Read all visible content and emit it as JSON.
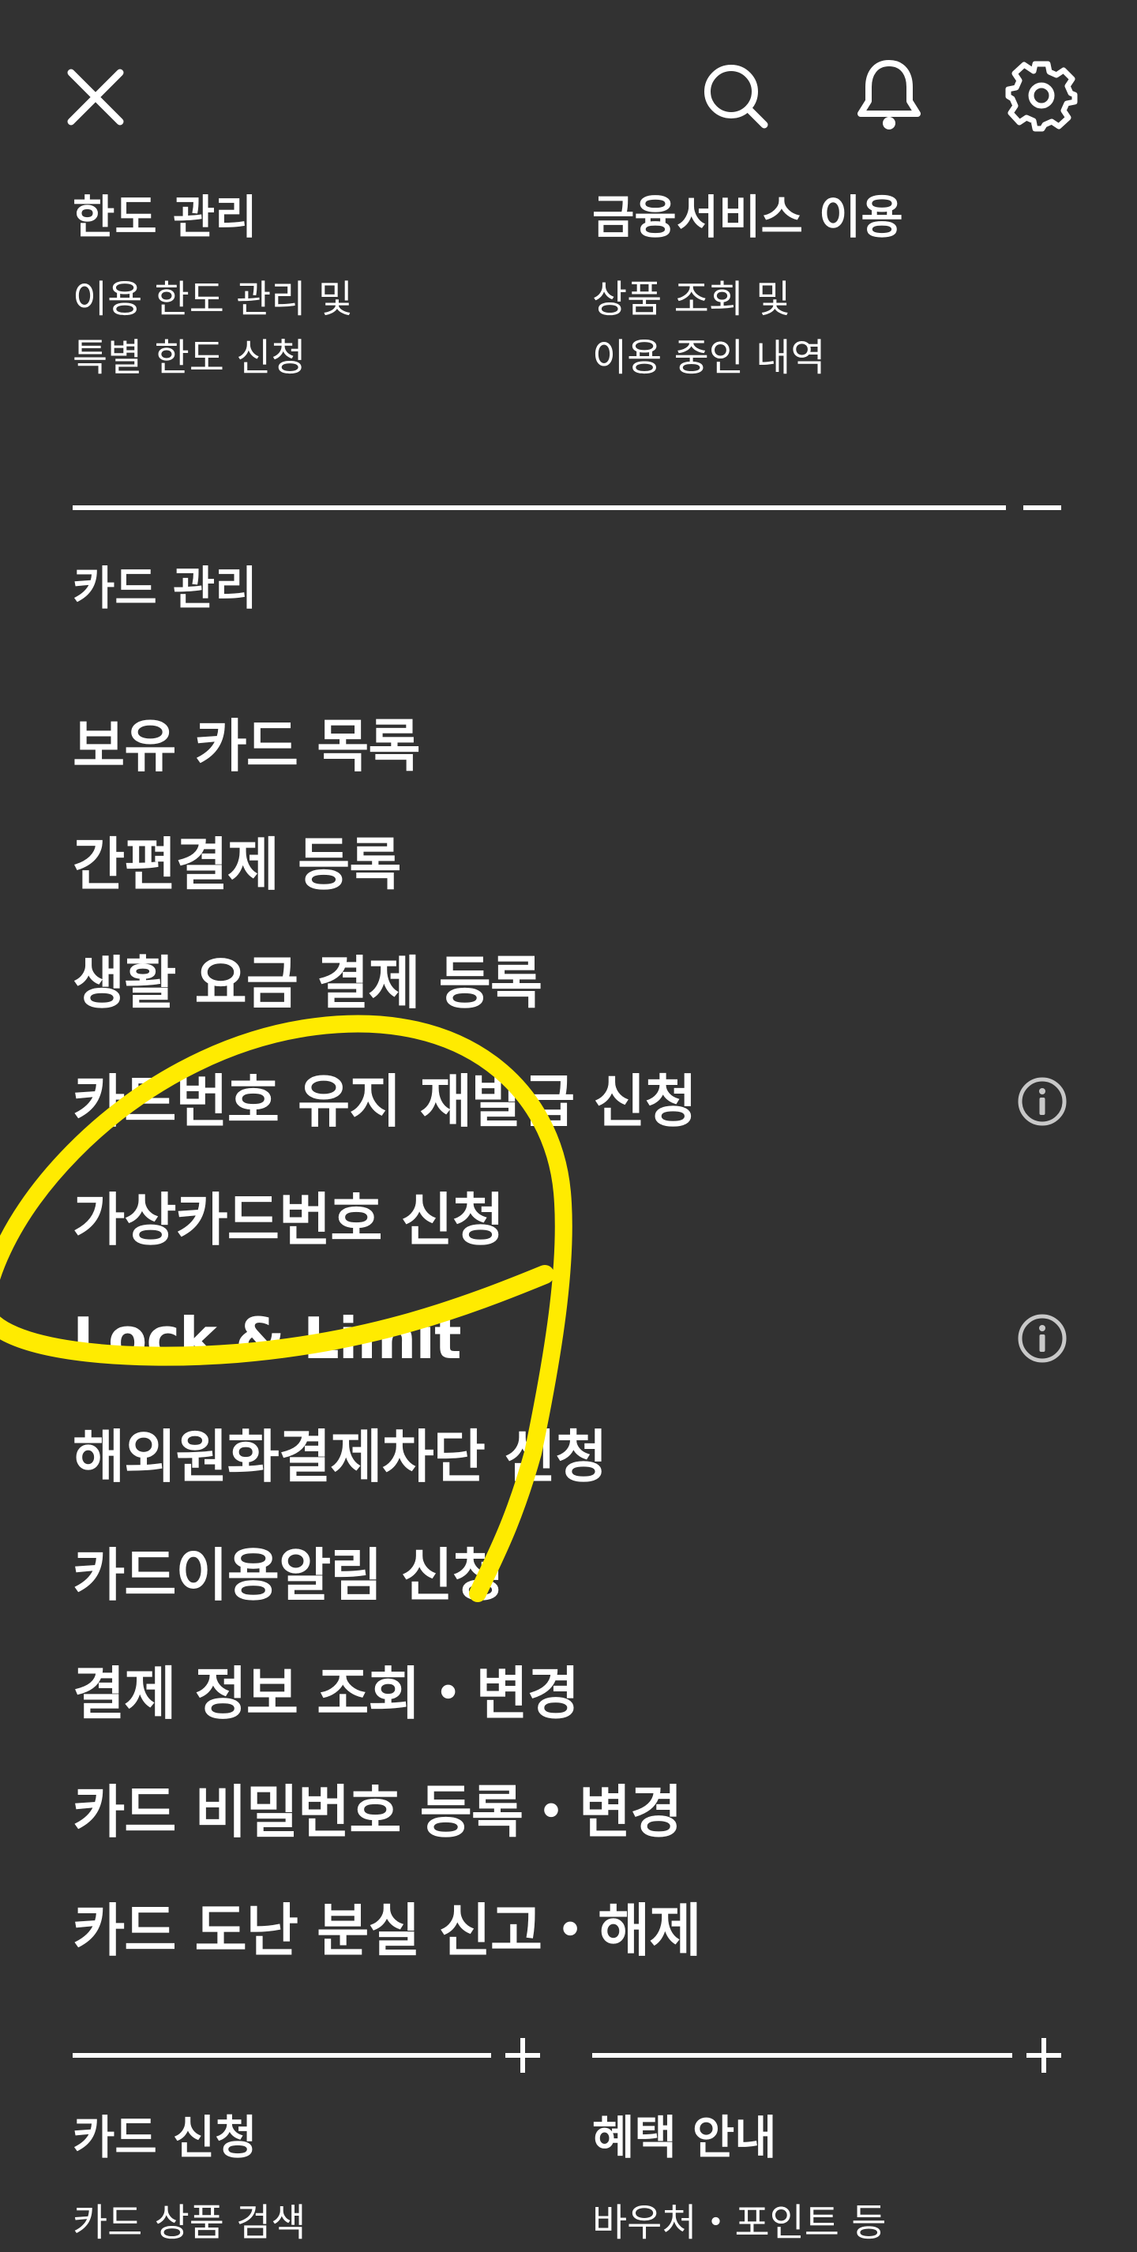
{
  "header": {
    "icons": [
      "close-icon",
      "search-icon",
      "bell-icon",
      "gear-icon"
    ]
  },
  "top_sections": [
    {
      "title": "한도 관리",
      "desc_line1": "이용 한도 관리 및",
      "desc_line2": "특별 한도 신청"
    },
    {
      "title": "금융서비스 이용",
      "desc_line1": "상품 조회 및",
      "desc_line2": "이용 중인 내역"
    }
  ],
  "card_management": {
    "section_label": "카드 관리",
    "toggle_icon": "minus-icon",
    "items": [
      {
        "label": "보유 카드 목록",
        "info": false
      },
      {
        "label": "간편결제 등록",
        "info": false
      },
      {
        "label": "생활 요금 결제 등록",
        "info": false
      },
      {
        "label": "카드번호 유지 재발급 신청",
        "info": true
      },
      {
        "label": "가상카드번호 신청",
        "info": false
      },
      {
        "label": "Lock & Limit",
        "info": true
      },
      {
        "label": "해외원화결제차단 신청",
        "info": false
      },
      {
        "label": "카드이용알림 신청",
        "info": false
      },
      {
        "label": "결제 정보 조회・변경",
        "info": false
      },
      {
        "label": "카드 비밀번호 등록・변경",
        "info": false
      },
      {
        "label": "카드 도난 분실 신고・해제",
        "info": false
      }
    ]
  },
  "bottom_sections": [
    {
      "title": "카드 신청",
      "desc": "카드 상품 검색",
      "toggle_icon": "plus-icon"
    },
    {
      "title": "혜택 안내",
      "desc": "바우처・포인트 등",
      "toggle_icon": "plus-icon"
    }
  ],
  "colors": {
    "background": "#323232",
    "text": "#ffffff",
    "info_icon": "#c8c8c8",
    "annotation": "#ffeb00"
  }
}
